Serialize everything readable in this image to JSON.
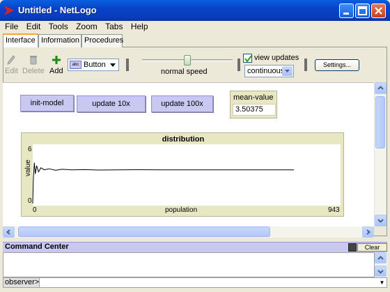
{
  "window": {
    "title": "Untitled - NetLogo",
    "minimize_icon": "minimize-icon",
    "maximize_icon": "maximize-icon",
    "close_icon": "close-icon"
  },
  "menu": [
    "File",
    "Edit",
    "Tools",
    "Zoom",
    "Tabs",
    "Help"
  ],
  "tabs": [
    "Interface",
    "Information",
    "Procedures"
  ],
  "toolbar": {
    "edit_label": "Edit",
    "delete_label": "Delete",
    "add_label": "Add",
    "widget_type": "Button",
    "speed_label": "normal speed",
    "view_updates_label": "view updates",
    "view_updates_checked": true,
    "update_mode": "continuous",
    "settings_label": "Settings..."
  },
  "widgets": {
    "buttons": [
      "init-model",
      "update 10x",
      "update 100x"
    ],
    "monitor": {
      "label": "mean-value",
      "value": "3.50375"
    }
  },
  "plot": {
    "title": "distribution",
    "ylabel": "value",
    "xlabel": "population",
    "ymin_label": "0",
    "ymax_label": "6",
    "xmin_label": "0",
    "xmax_label": "943"
  },
  "chart_data": {
    "type": "line",
    "title": "distribution",
    "xlabel": "population",
    "ylabel": "value",
    "xlim": [
      0,
      943
    ],
    "ylim": [
      0,
      6
    ],
    "series": [
      {
        "x": [
          0,
          2,
          5,
          8,
          12,
          18,
          25,
          35,
          50,
          70,
          90,
          120,
          160,
          200,
          260,
          320,
          400,
          480,
          560,
          640,
          720,
          800
        ],
        "y": [
          0.2,
          2.6,
          4.2,
          3.1,
          3.9,
          3.3,
          3.7,
          3.5,
          3.6,
          3.45,
          3.55,
          3.5,
          3.52,
          3.48,
          3.5,
          3.51,
          3.5,
          3.5,
          3.49,
          3.5,
          3.5,
          3.5
        ]
      }
    ]
  },
  "command_center": {
    "title": "Command Center",
    "clear_label": "Clear",
    "prompt": "observer>"
  },
  "colors": {
    "button_bg": "#c8c8f0",
    "monitor_bg": "#e8e7c4",
    "titlebar": "#0843c8"
  }
}
